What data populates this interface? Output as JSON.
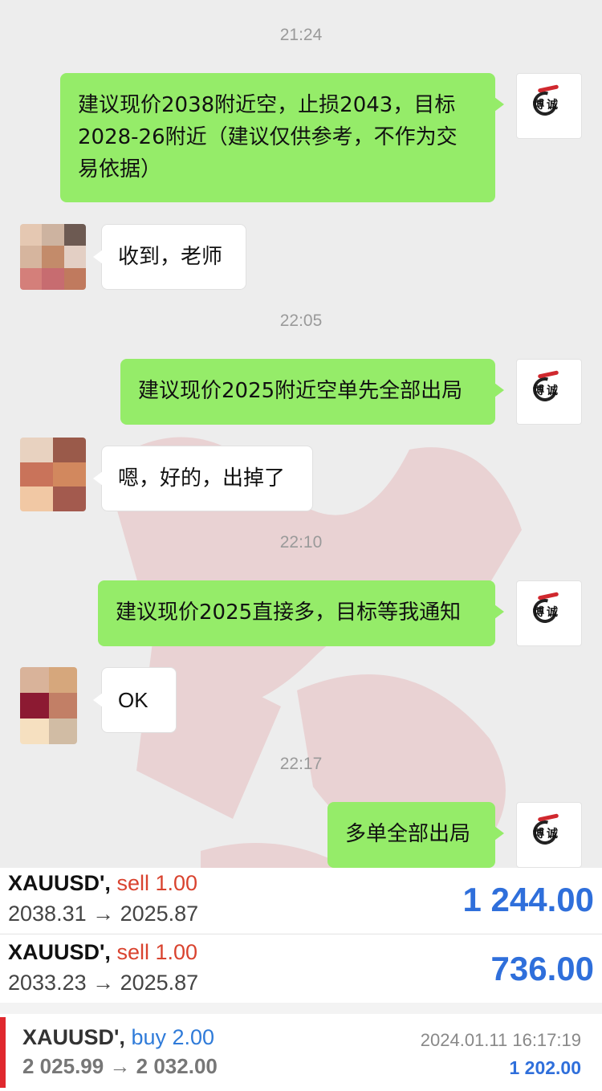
{
  "chat": {
    "messages": [
      {
        "kind": "time",
        "text": "21:24"
      },
      {
        "kind": "me",
        "sender": "博诚",
        "text": "建议现价2038附近空，止损2043，目标2028-26附近（建议仅供参考，不作为交易依据）"
      },
      {
        "kind": "other",
        "text": "收到，老师"
      },
      {
        "kind": "time",
        "text": "22:05"
      },
      {
        "kind": "me",
        "sender": "博诚",
        "text": "建议现价2025附近空单先全部出局"
      },
      {
        "kind": "other",
        "text": "嗯，好的，出掉了"
      },
      {
        "kind": "time",
        "text": "22:10"
      },
      {
        "kind": "me",
        "sender": "博诚",
        "text": "建议现价2025直接多，目标等我通知"
      },
      {
        "kind": "other",
        "text": "OK"
      },
      {
        "kind": "time",
        "text": "22:17"
      },
      {
        "kind": "me",
        "sender": "博诚",
        "text": "多单全部出局"
      }
    ],
    "logo_text": "博诚"
  },
  "trades": [
    {
      "symbol": "XAUUSD',",
      "side": "sell 1.00",
      "prices": "2038.31 → 2025.87",
      "profit": "1 244.00"
    },
    {
      "symbol": "XAUUSD',",
      "side": "sell 1.00",
      "prices": "2033.23 → 2025.87",
      "profit": "736.00"
    }
  ],
  "last_trade": {
    "symbol": "XAUUSD',",
    "side": "buy 2.00",
    "prices": "2 025.99 → 2 032.00",
    "datetime": "2024.01.11 16:17:19",
    "profit": "1 202.00"
  },
  "colors": {
    "my_bubble": "#95ec69",
    "sell": "#d9432f",
    "buy": "#2f7bd9",
    "profit": "#2f6fdb",
    "accent_bar": "#e0282e"
  },
  "icons": [
    "logo-icon",
    "avatar-mosaic"
  ]
}
